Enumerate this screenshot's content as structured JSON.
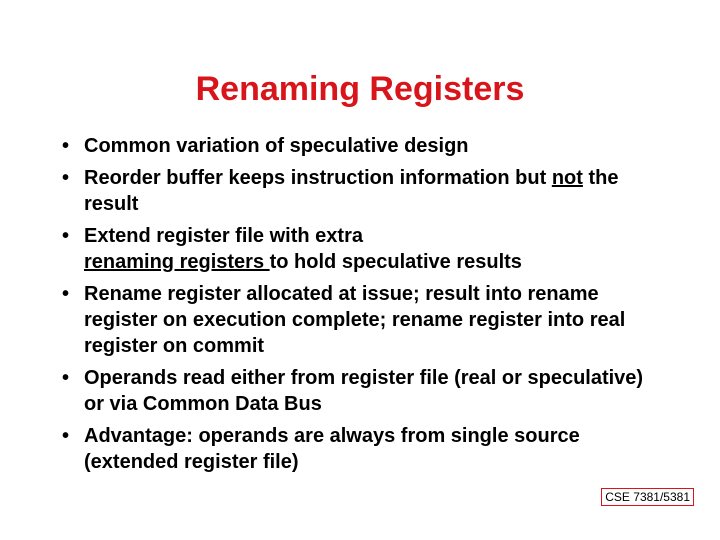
{
  "title": "Renaming Registers",
  "bullets": {
    "b1": "Common variation of speculative design",
    "b2a": "Reorder buffer keeps instruction information but ",
    "b2u": "not",
    "b2b": " the result",
    "b3a": "Extend register file with extra ",
    "b3u": "renaming registers ",
    "b3b": "to hold speculative results",
    "b4": "Rename register allocated at issue; result into rename register on execution complete; rename register into real register on commit",
    "b5": "Operands read either from register file (real or speculative) or via Common Data Bus",
    "b6": "Advantage: operands are always from single source (extended register file)"
  },
  "footer": "CSE 7381/5381"
}
